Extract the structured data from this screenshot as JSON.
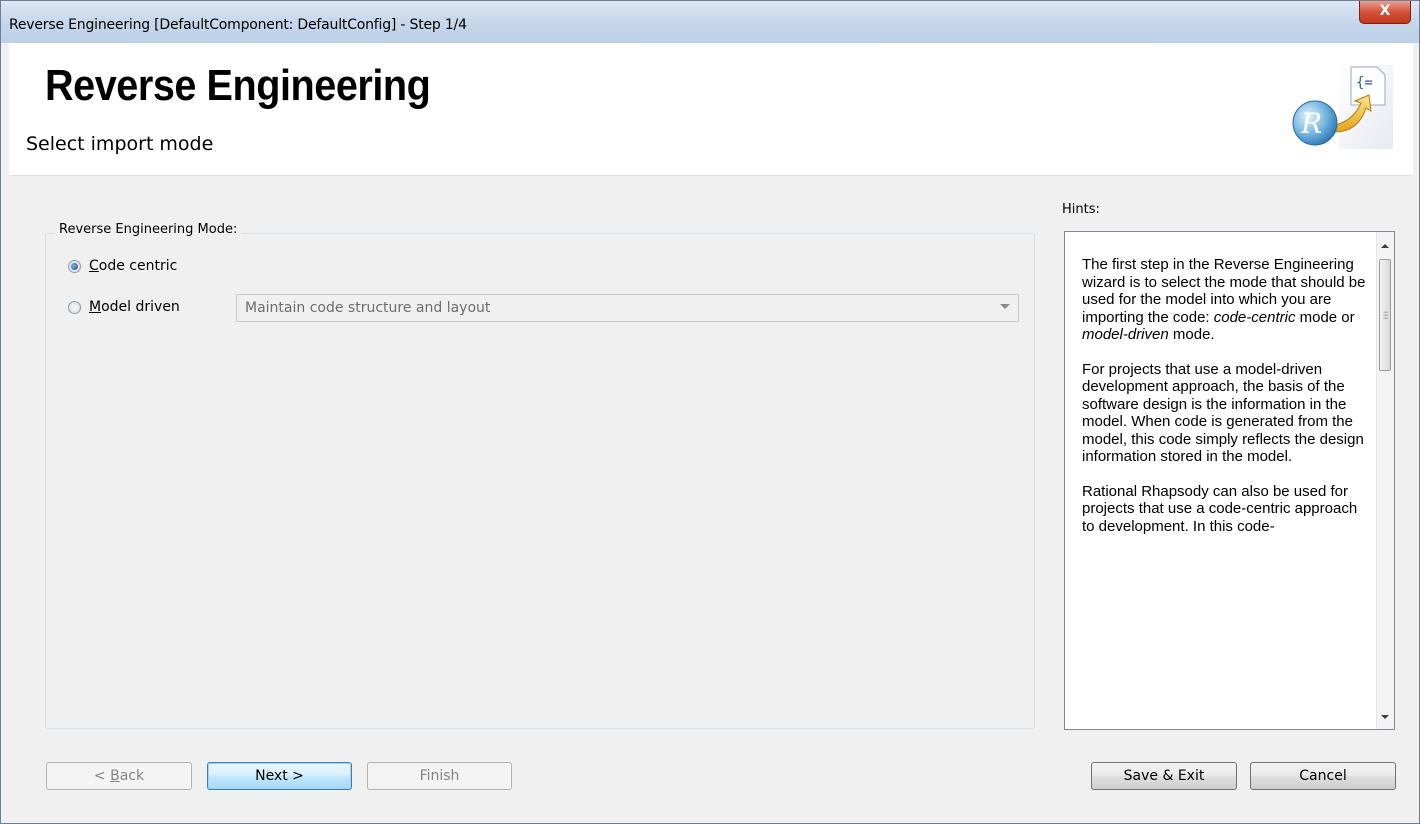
{
  "window": {
    "title": "Reverse Engineering [DefaultComponent: DefaultConfig] - Step 1/4",
    "close_label": "X"
  },
  "header": {
    "title": "Reverse Engineering",
    "subtitle": "Select import mode",
    "logo_icon": "rhapsody-reverse-engineering-logo"
  },
  "mode_group": {
    "legend": "Reverse Engineering Mode:",
    "options": [
      {
        "label_mnemonic": "C",
        "label_rest": "ode centric",
        "selected": true
      },
      {
        "label_mnemonic": "M",
        "label_rest": "odel driven",
        "selected": false
      }
    ],
    "model_driven_select": {
      "value": "Maintain code structure and layout",
      "enabled": false
    }
  },
  "hints": {
    "label": "Hints:",
    "paragraphs": [
      [
        "The first step in the Reverse Engineering wizard is to select the mode that should be used for the model into which you are importing the code: ",
        "code-centric",
        " mode or ",
        "model-driven",
        " mode."
      ],
      [
        "For projects that use a model-driven development approach, the basis of the software design is the information in the model. When code is generated from the model, this code simply reflects the design information stored in the model."
      ],
      [
        "Rational Rhapsody can also be used for projects that use a code-centric approach to development. In this code-"
      ]
    ]
  },
  "buttons": {
    "back_prefix": "< ",
    "back_mnemonic": "B",
    "back_rest": "ack",
    "next": "Next >",
    "finish": "Finish",
    "save_exit": "Save & Exit",
    "cancel": "Cancel"
  },
  "colors": {
    "title_bar": "#c9d8ec",
    "close_button": "#d5533b",
    "default_button": "#bee6fd"
  }
}
